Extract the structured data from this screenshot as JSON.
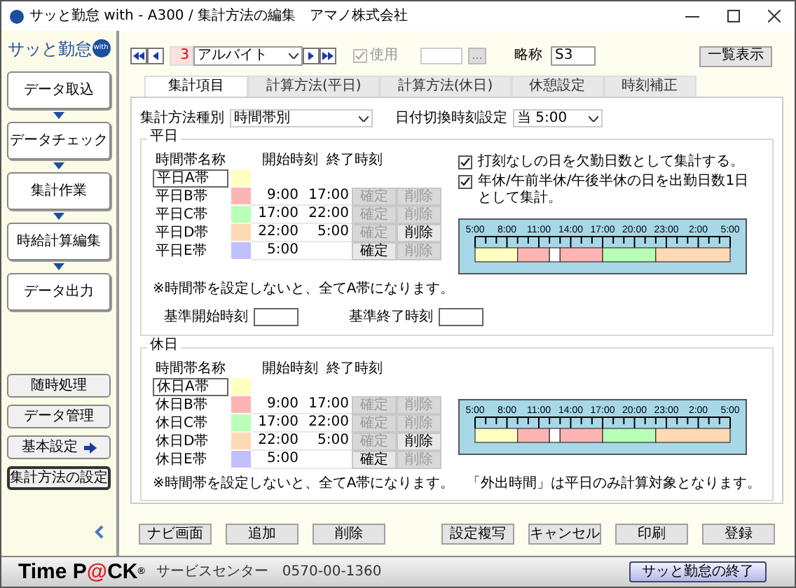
{
  "window": {
    "title": "サッと勤怠 with - A300 / 集計方法の編集　アマノ株式会社"
  },
  "sidebar": {
    "logo": "サッと勤怠",
    "logo_badge": "with",
    "flow_buttons": [
      "データ取込",
      "データチェック",
      "集計作業",
      "時給計算編集",
      "データ出力"
    ],
    "other_buttons": [
      {
        "label": "随時処理",
        "selected": false,
        "arrow": false
      },
      {
        "label": "データ管理",
        "selected": false,
        "arrow": false
      },
      {
        "label": "基本設定",
        "selected": false,
        "arrow": true
      },
      {
        "label": "集計方法の設定",
        "selected": true,
        "arrow": false
      }
    ]
  },
  "toolbar": {
    "number": "3",
    "type_select": "アルバイト",
    "use_label": "使用",
    "use_checked": true,
    "use_disabled": true,
    "browse_button": "...",
    "abbr_label": "略称",
    "abbr_value": "S3",
    "list_button": "一覧表示"
  },
  "tabs": [
    {
      "label": "集計項目",
      "selected": true
    },
    {
      "label": "計算方法(平日)",
      "selected": false
    },
    {
      "label": "計算方法(休日)",
      "selected": false
    },
    {
      "label": "休憩設定",
      "selected": false
    },
    {
      "label": "時刻補正",
      "selected": false
    }
  ],
  "method_label": "集計方法種別",
  "method_value": "時間帯別",
  "switch_label": "日付切換時刻設定",
  "switch_value": "当 5:00",
  "sections": [
    {
      "title": "平日",
      "headers": [
        "時間帯名称",
        "開始時刻",
        "終了時刻"
      ],
      "rows": [
        {
          "name": "平日A帯",
          "color": "#ffffc0"
        },
        {
          "name": "平日B帯",
          "color": "#ffb4b4",
          "start": "9:00",
          "end": "17:00",
          "confirm": "確定",
          "confirm_disabled": true,
          "delete": "削除",
          "delete_disabled": true
        },
        {
          "name": "平日C帯",
          "color": "#b8ffb8",
          "start": "17:00",
          "end": "22:00",
          "confirm": "確定",
          "confirm_disabled": true,
          "delete": "削除",
          "delete_disabled": true
        },
        {
          "name": "平日D帯",
          "color": "#ffd8b4",
          "start": "22:00",
          "end": "5:00",
          "confirm": "確定",
          "confirm_disabled": true,
          "delete": "削除",
          "delete_disabled": false
        },
        {
          "name": "平日E帯",
          "color": "#c0c0ff",
          "start": "5:00",
          "confirm": "確定",
          "confirm_disabled": false,
          "delete": "削除",
          "delete_disabled": true
        }
      ],
      "note": "※時間帯を設定しないと、全てA帯になります。",
      "base_start_label": "基準開始時刻",
      "base_end_label": "基準終了時刻",
      "checks": [
        {
          "label": "打刻なしの日を欠勤日数として集計する。",
          "checked": true
        },
        {
          "label": "年休/午前半休/午後半休の日を出勤日数1日として集計。",
          "checked": true
        }
      ],
      "ticks": [
        "5:00",
        "8:00",
        "11:00",
        "14:00",
        "17:00",
        "20:00",
        "23:00",
        "2:00",
        "5:00"
      ]
    },
    {
      "title": "休日",
      "headers": [
        "時間帯名称",
        "開始時刻",
        "終了時刻"
      ],
      "rows": [
        {
          "name": "休日A帯",
          "color": "#ffffc0"
        },
        {
          "name": "休日B帯",
          "color": "#ffb4b4",
          "start": "9:00",
          "end": "17:00",
          "confirm": "確定",
          "confirm_disabled": true,
          "delete": "削除",
          "delete_disabled": true
        },
        {
          "name": "休日C帯",
          "color": "#b8ffb8",
          "start": "17:00",
          "end": "22:00",
          "confirm": "確定",
          "confirm_disabled": true,
          "delete": "削除",
          "delete_disabled": true
        },
        {
          "name": "休日D帯",
          "color": "#ffd8b4",
          "start": "22:00",
          "end": "5:00",
          "confirm": "確定",
          "confirm_disabled": true,
          "delete": "削除",
          "delete_disabled": false
        },
        {
          "name": "休日E帯",
          "color": "#c0c0ff",
          "start": "5:00",
          "confirm": "確定",
          "confirm_disabled": false,
          "delete": "削除",
          "delete_disabled": true
        }
      ],
      "note": "※時間帯を設定しないと、全てA帯になります。",
      "side_note": "「外出時間」は平日のみ計算対象となります。",
      "ticks": [
        "5:00",
        "8:00",
        "11:00",
        "14:00",
        "17:00",
        "20:00",
        "23:00",
        "2:00",
        "5:00"
      ]
    }
  ],
  "left_buttons": [
    "ナビ画面",
    "追加",
    "削除"
  ],
  "right_buttons": [
    "設定複写",
    "キャンセル",
    "印刷",
    "登録"
  ],
  "footer": {
    "logo_parts": [
      {
        "text": "Time P",
        "accent": false
      },
      {
        "text": "@",
        "accent": true
      },
      {
        "text": "CK",
        "accent": false
      }
    ],
    "logo_mark": "®",
    "service": "サービスセンター　0570-00-1360",
    "exit_button": "サッと勤怠の終了"
  }
}
